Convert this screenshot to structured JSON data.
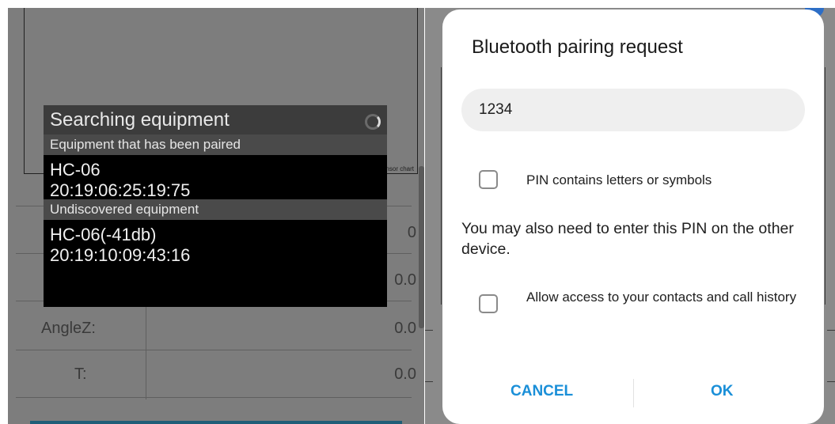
{
  "left_screen": {
    "chart_label": "Sensor chart",
    "table": [
      {
        "label": "",
        "value": ""
      },
      {
        "label": "",
        "value": "0"
      },
      {
        "label": "",
        "value": "0.0"
      },
      {
        "label": "AngleZ:",
        "value": "0.0"
      },
      {
        "label": "T:",
        "value": "0.0"
      }
    ],
    "search_dialog": {
      "title": "Searching equipment",
      "paired_header": "Equipment that has been paired",
      "paired_devices": [
        {
          "name": "HC-06",
          "address": "20:19:06:25:19:75"
        }
      ],
      "undiscovered_header": "Undiscovered equipment",
      "undiscovered_devices": [
        {
          "name": "HC-06(-41db)",
          "address": "20:19:10:09:43:16"
        }
      ]
    }
  },
  "pairing_dialog": {
    "title": "Bluetooth pairing request",
    "pin_value": "1234",
    "pin_letters_label": "PIN contains letters or symbols",
    "message": "You may also need to enter this PIN on the other device.",
    "allow_access_label": "Allow access to your contacts and call history",
    "cancel_label": "CANCEL",
    "ok_label": "OK"
  },
  "colors": {
    "accent": "#1a8fd8",
    "dim_overlay": "#7d7d7d"
  }
}
